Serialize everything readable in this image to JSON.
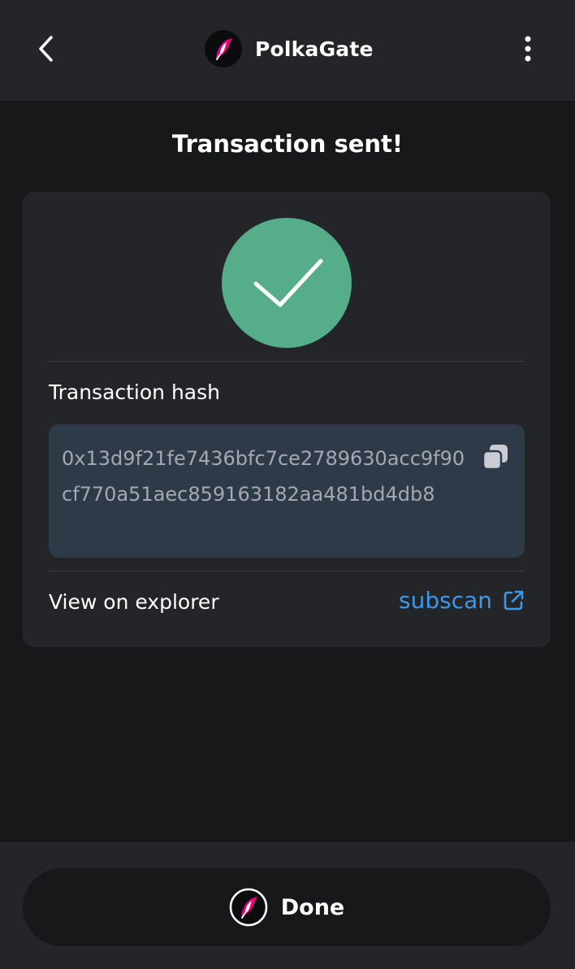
{
  "header": {
    "app_name": "PolkaGate",
    "logo_icon": "polkagate-logo-icon",
    "back_icon": "chevron-left-icon",
    "menu_icon": "more-vertical-icon"
  },
  "page": {
    "title": "Transaction sent!"
  },
  "card": {
    "status_icon": "checkmark-icon",
    "hash_label": "Transaction hash",
    "hash_value": "0x13d9f21fe7436bfc7ce2789630acc9f90cf770a51aec859163182aa481bd4db8",
    "copy_icon": "copy-icon",
    "explorer_label": "View on explorer",
    "explorer_link": "subscan",
    "external_icon": "external-link-icon"
  },
  "footer": {
    "done_label": "Done"
  },
  "colors": {
    "background": "#17181a",
    "panel": "#242528",
    "success": "#55ad8a",
    "hash_box": "#2e3a48",
    "link": "#3d99e8",
    "brand_pink": "#e6007a"
  }
}
